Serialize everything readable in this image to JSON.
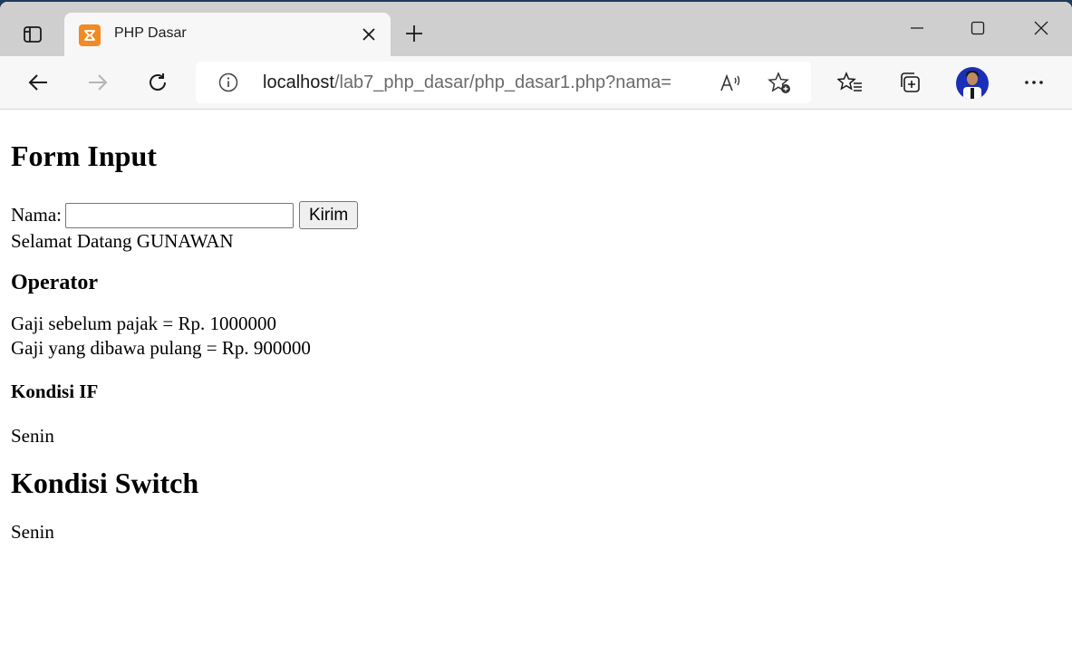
{
  "browser": {
    "tab": {
      "title": "PHP Dasar"
    },
    "address": {
      "host": "localhost",
      "path": "/lab7_php_dasar/php_dasar1.php?nama="
    },
    "colors": {
      "accent_favicon": "#f08a24",
      "tabstrip": "#cfcfcf"
    }
  },
  "page": {
    "form_heading": "Form Input",
    "name_label": "Nama:",
    "name_value": "",
    "submit_label": "Kirim",
    "greeting": "Selamat Datang GUNAWAN",
    "operator_heading": "Operator",
    "salary_before": "Gaji sebelum pajak = Rp. 1000000",
    "salary_after": "Gaji yang dibawa pulang = Rp. 900000",
    "if_heading": "Kondisi IF",
    "if_result": "Senin",
    "switch_heading": "Kondisi Switch",
    "switch_result": "Senin"
  }
}
